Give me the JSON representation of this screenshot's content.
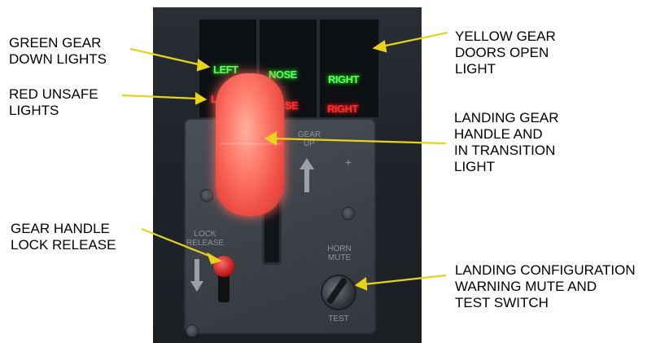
{
  "panel_lights": {
    "green": {
      "left": "LEFT",
      "nose": "NOSE",
      "right": "RIGHT"
    },
    "red": {
      "left_partial": "L",
      "nose_partial": "SE",
      "right": "RIGHT"
    }
  },
  "panel_markings": {
    "gear_up": "GEAR\nUP",
    "lock_release": "LOCK\nRELEASE",
    "horn_mute": "HORN\nMUTE",
    "test": "TEST"
  },
  "callouts": {
    "green_gear": "GREEN GEAR\nDOWN LIGHTS",
    "red_unsafe": "RED UNSAFE\nLIGHTS",
    "gear_lock": "GEAR HANDLE\nLOCK RELEASE",
    "yellow_doors": "YELLOW GEAR\nDOORS OPEN\nLIGHT",
    "landing_handle": "LANDING GEAR\nHANDLE AND\nIN TRANSITION\nLIGHT",
    "config_warning": "LANDING CONFIGURATION\nWARNING MUTE AND\nTEST SWITCH"
  },
  "colors": {
    "leader_line": "#e8d21a",
    "gear_down_light": "#5cff5c",
    "unsafe_light": "#ff2d2d",
    "handle_glow": "#ff6a5a"
  }
}
